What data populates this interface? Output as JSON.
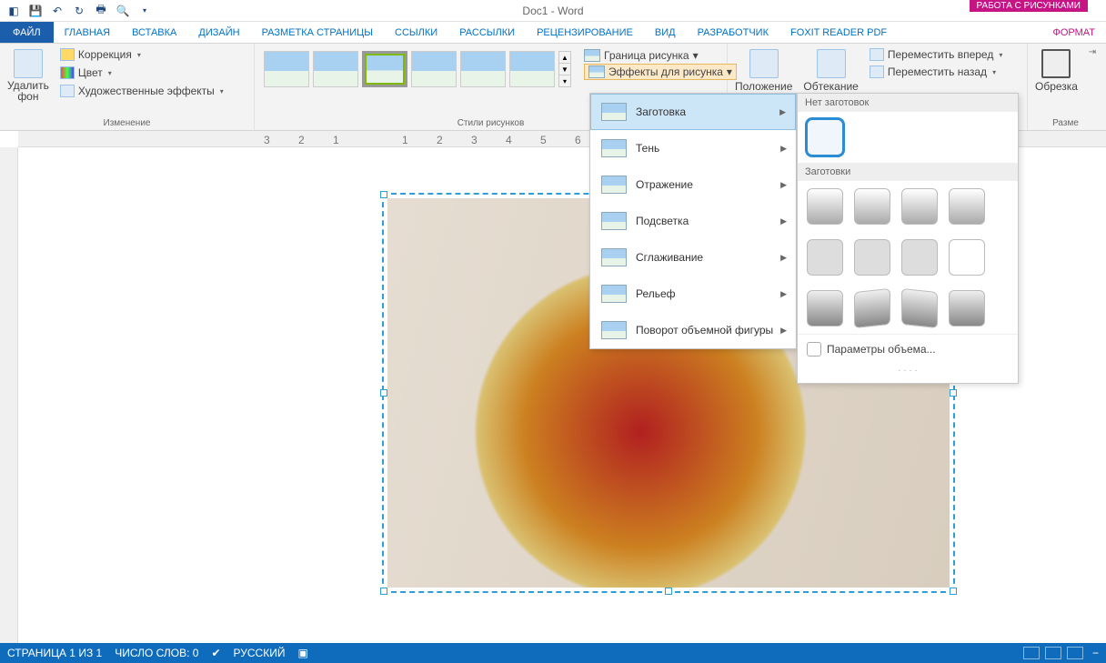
{
  "titlebar": {
    "doc_title": "Doc1 - Word",
    "context_label": "РАБОТА С РИСУНКАМИ"
  },
  "tabs": {
    "file": "ФАЙЛ",
    "items": [
      "ГЛАВНАЯ",
      "ВСТАВКА",
      "ДИЗАЙН",
      "РАЗМЕТКА СТРАНИЦЫ",
      "ССЫЛКИ",
      "РАССЫЛКИ",
      "РЕЦЕНЗИРОВАНИЕ",
      "ВИД",
      "РАЗРАБОТЧИК",
      "FOXIT READER PDF"
    ],
    "format": "ФОРМАТ"
  },
  "ribbon": {
    "group1": {
      "title": "Изменение",
      "remove_bg": "Удалить\nфон",
      "correction": "Коррекция",
      "color": "Цвет",
      "artistic": "Художественные эффекты"
    },
    "group2": {
      "title": "Стили рисунков",
      "border": "Граница рисунка",
      "effects": "Эффекты для рисунка"
    },
    "arrange": {
      "position": "Положение",
      "wrap": "Обтекание",
      "forward": "Переместить вперед",
      "backward": "Переместить назад"
    },
    "crop": {
      "label": "Обрезка"
    },
    "size_lbl": "Разме"
  },
  "fx_menu": {
    "items": [
      "Заготовка",
      "Тень",
      "Отражение",
      "Подсветка",
      "Сглаживание",
      "Рельеф",
      "Поворот объемной фигуры"
    ]
  },
  "presets": {
    "hdr_none": "Нет заготовок",
    "hdr_presets": "Заготовки",
    "options": "Параметры объема..."
  },
  "ruler_ticks": [
    "3",
    "2",
    "1",
    "",
    "1",
    "2",
    "3",
    "4",
    "5",
    "6"
  ],
  "status": {
    "page": "СТРАНИЦА 1 ИЗ 1",
    "words": "ЧИСЛО СЛОВ: 0",
    "lang": "РУССКИЙ"
  }
}
